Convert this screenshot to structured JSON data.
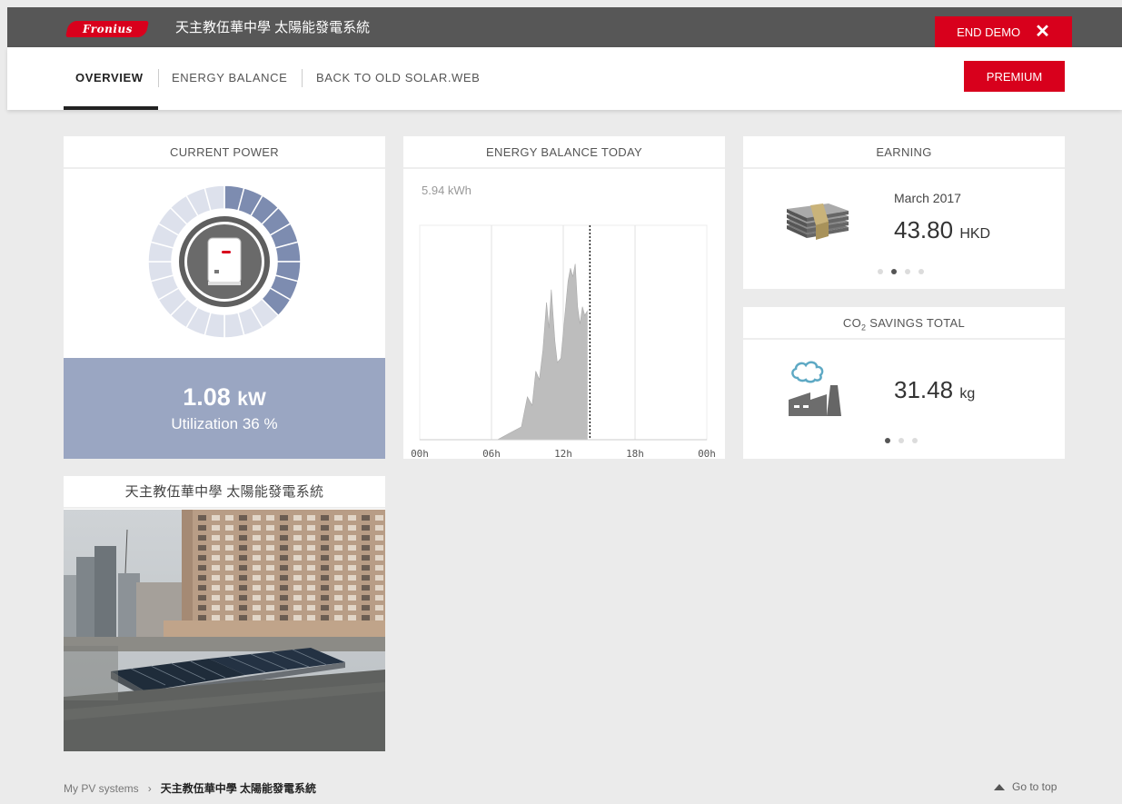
{
  "header": {
    "logo_text": "Fronius",
    "system_title": "天主教伍華中學 太陽能發電系統",
    "end_demo_label": "END DEMO",
    "end_demo_icon": "✕"
  },
  "nav": {
    "tabs": [
      {
        "label": "OVERVIEW",
        "active": true
      },
      {
        "label": "ENERGY BALANCE",
        "active": false
      },
      {
        "label": "BACK TO OLD SOLAR.WEB",
        "active": false
      }
    ],
    "premium_label": "PREMIUM"
  },
  "current_power": {
    "title": "CURRENT POWER",
    "value": "1.08",
    "unit": "kW",
    "utilization": "Utilization 36 %",
    "utilization_fraction": 0.36,
    "colors": {
      "panel": "#9aa6c2",
      "ring_active": "#7d8cb0",
      "ring_inactive": "#dde1ec"
    }
  },
  "energy_balance": {
    "title": "ENERGY BALANCE TODAY",
    "total": "5.94 kWh",
    "chart_data": {
      "type": "area",
      "x_tick_labels": [
        "00h",
        "06h",
        "12h",
        "18h",
        "00h"
      ],
      "xlim": [
        0,
        24
      ],
      "current_time_hours": 14.0,
      "series": [
        {
          "values": [
            [
              0,
              0
            ],
            [
              6.5,
              0
            ],
            [
              7.5,
              0.03
            ],
            [
              8.5,
              0.06
            ],
            [
              9.0,
              0.2
            ],
            [
              9.4,
              0.16
            ],
            [
              9.7,
              0.32
            ],
            [
              10.0,
              0.28
            ],
            [
              10.3,
              0.42
            ],
            [
              10.6,
              0.64
            ],
            [
              10.8,
              0.52
            ],
            [
              11.0,
              0.7
            ],
            [
              11.3,
              0.46
            ],
            [
              11.5,
              0.36
            ],
            [
              11.8,
              0.38
            ],
            [
              12.1,
              0.56
            ],
            [
              12.4,
              0.74
            ],
            [
              12.6,
              0.8
            ],
            [
              12.8,
              0.76
            ],
            [
              13.0,
              0.82
            ],
            [
              13.2,
              0.62
            ],
            [
              13.4,
              0.54
            ],
            [
              13.6,
              0.62
            ],
            [
              13.8,
              0.58
            ],
            [
              14.0,
              0.6
            ],
            [
              14.0,
              0
            ]
          ],
          "color": "#bdbdbd"
        }
      ]
    }
  },
  "earning": {
    "title": "EARNING",
    "month": "March 2017",
    "value": "43.80",
    "unit": "HKD",
    "slides": 4,
    "active_slide": 1,
    "icon": "money-stack-icon"
  },
  "co2": {
    "title_main": "CO",
    "title_sub": "2",
    "title_rest": " SAVINGS TOTAL",
    "value": "31.48",
    "unit": "kg",
    "slides": 3,
    "active_slide": 0,
    "icon": "factory-icon"
  },
  "photo_card": {
    "title": "天主教伍華中學 太陽能發電系統"
  },
  "footer": {
    "breadcrumb_root": "My PV systems",
    "breadcrumb_sep": "›",
    "breadcrumb_current": "天主教伍華中學 太陽能發電系統",
    "go_top_label": "Go to top"
  }
}
